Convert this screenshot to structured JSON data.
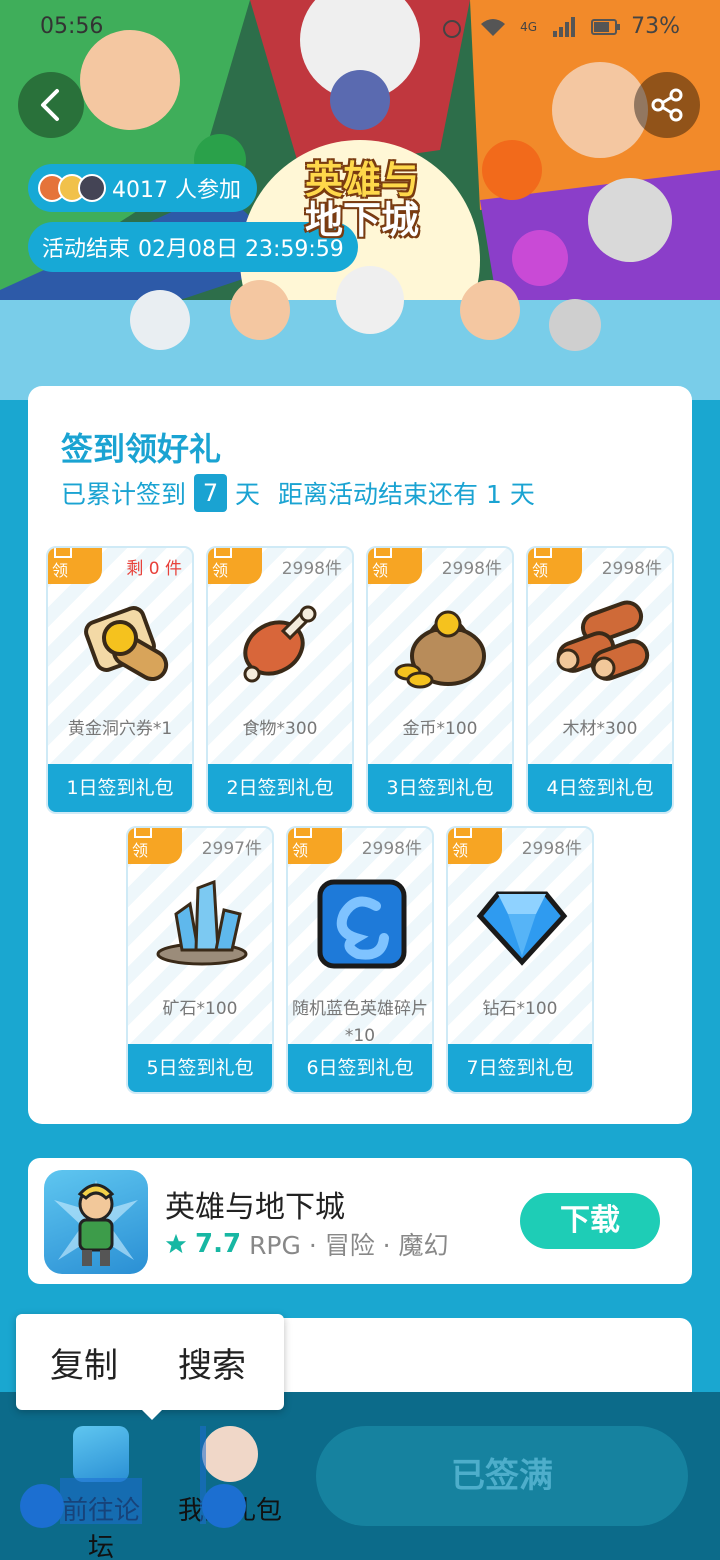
{
  "status_bar": {
    "time": "05:56",
    "network": "4G",
    "battery": "73%"
  },
  "banner": {
    "participants": "4017 人参加",
    "end_time_label": "活动结束",
    "end_time_value": "02月08日 23:59:59",
    "logo_line1": "英雄与",
    "logo_line2": "地下城"
  },
  "checkin": {
    "title": "签到领好礼",
    "signed_prefix": "已累计签到",
    "signed_days": "7",
    "signed_suffix": "天",
    "remain_text": "距离活动结束还有 1 天",
    "claim_tag": "领",
    "gifts": [
      {
        "stock": "剩 0 件",
        "name": "黄金洞穴券*1",
        "button": "1日签到礼包",
        "icon": "golden-scroll-icon"
      },
      {
        "stock": "2998件",
        "name": "食物*300",
        "button": "2日签到礼包",
        "icon": "meat-icon"
      },
      {
        "stock": "2998件",
        "name": "金币*100",
        "button": "3日签到礼包",
        "icon": "coin-bag-icon"
      },
      {
        "stock": "2998件",
        "name": "木材*300",
        "button": "4日签到礼包",
        "icon": "wood-icon"
      },
      {
        "stock": "2997件",
        "name": "矿石*100",
        "button": "5日签到礼包",
        "icon": "crystal-ore-icon"
      },
      {
        "stock": "2998件",
        "name": "随机蓝色英雄碎片*10",
        "button": "6日签到礼包",
        "icon": "blue-hero-shard-icon"
      },
      {
        "stock": "2998件",
        "name": "钻石*100",
        "button": "7日签到礼包",
        "icon": "diamond-icon"
      }
    ]
  },
  "game": {
    "name": "英雄与地下城",
    "rating": "7.7",
    "tags": "RPG · 冒险 · 魔幻",
    "download_label": "下载"
  },
  "context_menu": {
    "copy": "复制",
    "search": "搜索"
  },
  "bottom_bar": {
    "forum_label": "前往论坛",
    "mygift_label": "我的礼包",
    "signed_label": "已签满"
  },
  "colors": {
    "accent": "#1aa7d6",
    "tag_orange": "#f7a523",
    "download": "#1ecdb6",
    "bottom_bar": "#0c6b8a"
  }
}
